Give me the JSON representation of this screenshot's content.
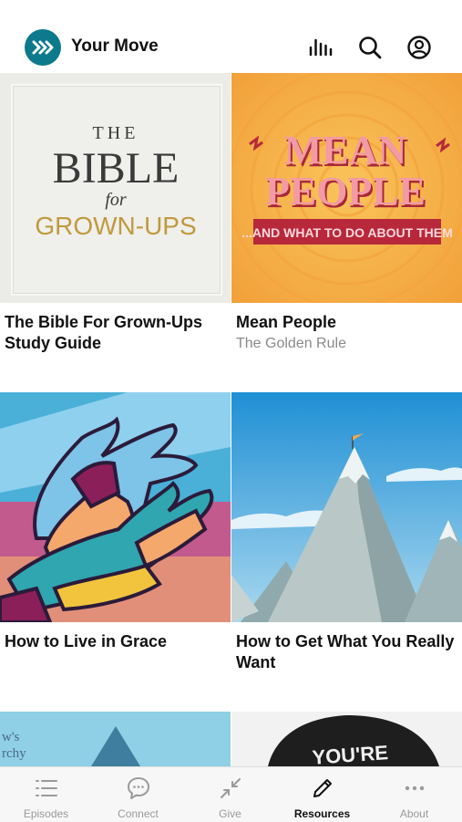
{
  "header": {
    "app_title": "Your Move",
    "icons": [
      "chevrons-logo-icon",
      "audio-bars-icon",
      "search-icon",
      "profile-icon"
    ]
  },
  "cards": [
    {
      "title": "The Bible For Grown-Ups Study Guide",
      "subtitle": "",
      "art_text": {
        "line1": "THE",
        "line2": "BIBLE",
        "line3": "for",
        "line4": "GROWN-UPS"
      }
    },
    {
      "title": "Mean People",
      "subtitle": "The Golden Rule",
      "art_text": {
        "line1": "MEAN",
        "line2": "PEOPLE",
        "line3": "...AND WHAT TO DO ABOUT THEM"
      }
    },
    {
      "title": "How to Live in Grace",
      "subtitle": ""
    },
    {
      "title": "How to Get What You Really Want",
      "subtitle": ""
    },
    {
      "title": "",
      "subtitle": "",
      "art_text": {
        "line1": "w's",
        "line2": "rchy"
      }
    },
    {
      "title": "",
      "subtitle": "",
      "art_text": {
        "line1": "YOU'RE"
      }
    }
  ],
  "tabbar": {
    "tabs": [
      {
        "label": "Episodes",
        "icon": "list-icon",
        "active": false
      },
      {
        "label": "Connect",
        "icon": "chat-bubble-icon",
        "active": false
      },
      {
        "label": "Give",
        "icon": "arrows-in-icon",
        "active": false
      },
      {
        "label": "Resources",
        "icon": "pencil-icon",
        "active": true
      },
      {
        "label": "About",
        "icon": "more-dots-icon",
        "active": false
      }
    ]
  },
  "colors": {
    "brand": "#0c7a8c",
    "active_tab": "#111111",
    "inactive_tab": "#9a9a9a"
  }
}
